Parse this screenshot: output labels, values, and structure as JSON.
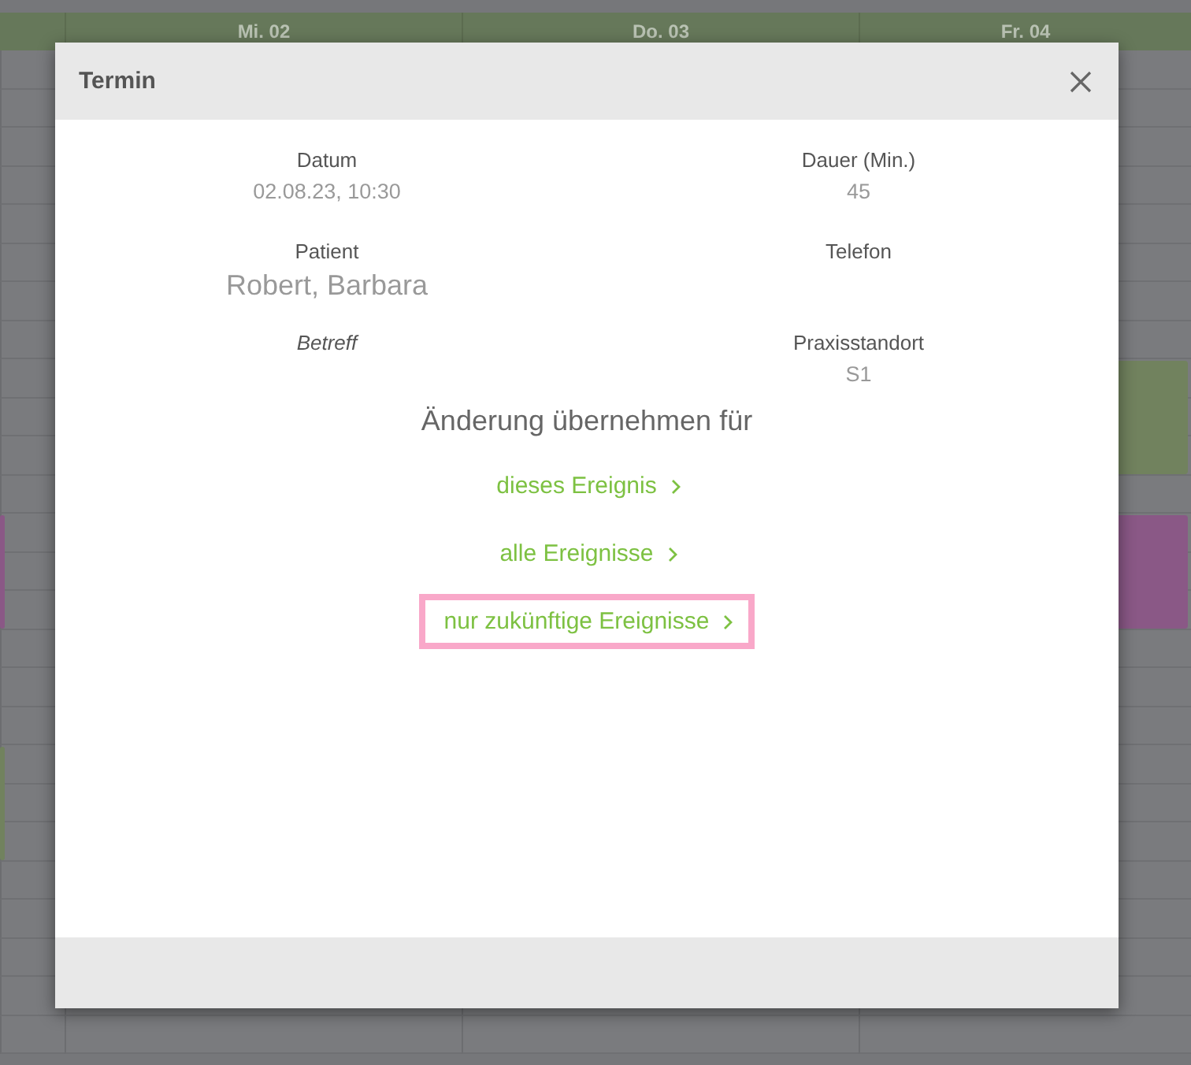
{
  "calendar": {
    "days": [
      {
        "label": "Mi. 02"
      },
      {
        "label": "Do. 03"
      },
      {
        "label": "Fr. 04"
      }
    ],
    "events": [
      {
        "color": "#71825e"
      },
      {
        "color": "#8a5886"
      },
      {
        "color": "#8a5886"
      },
      {
        "color": "#71825e"
      }
    ]
  },
  "dialog": {
    "title": "Termin",
    "fields": [
      {
        "label": "Datum",
        "value": "02.08.23, 10:30",
        "italic": false,
        "kind": "plain"
      },
      {
        "label": "Dauer (Min.)",
        "value": "45",
        "italic": false,
        "kind": "plain"
      },
      {
        "label": "Patient",
        "value": "Robert, Barbara",
        "italic": false,
        "kind": "large"
      },
      {
        "label": "Telefon",
        "italic": false
      },
      {
        "label": "Betreff",
        "italic": true
      },
      {
        "label": "Praxisstandort",
        "value": "S1",
        "italic": false,
        "kind": "plain"
      }
    ],
    "question": "Änderung übernehmen für",
    "options": [
      {
        "label": "dieses Ereignis",
        "highlighted": false
      },
      {
        "label": "alle Ereignisse",
        "highlighted": false
      },
      {
        "label": "nur zukünftige Ereignisse",
        "highlighted": true
      }
    ]
  }
}
